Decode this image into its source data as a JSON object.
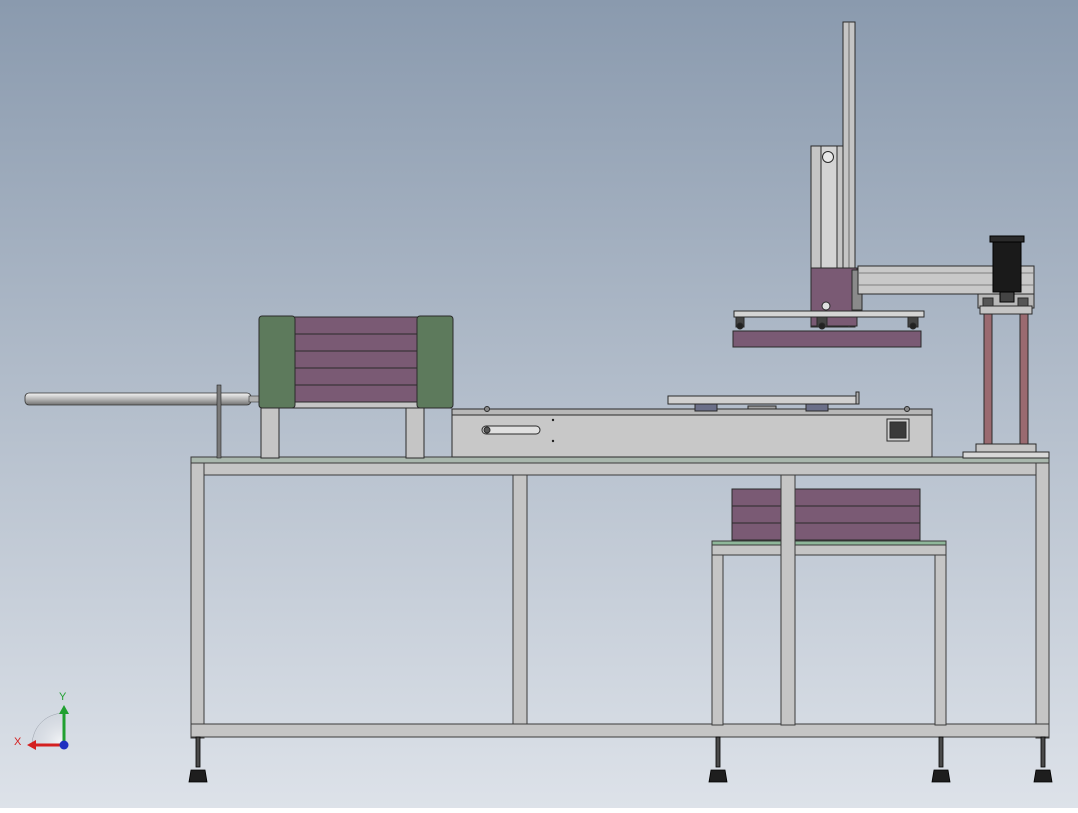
{
  "viewport": {
    "background_top": "#8a9aae",
    "background_bottom": "#dde2e9"
  },
  "colors": {
    "frame": "#c5c5c5",
    "frame_edge": "#3a3a3a",
    "purple_layer": "#7a5a74",
    "green_guard": "#5d7a5c",
    "dark_motor": "#1a1a1a",
    "rod_silver": "#d8d8d8",
    "x_axis": "#d42020",
    "y_axis": "#20a030",
    "z_axis": "#2030c0"
  },
  "triad": {
    "x_label": "X",
    "y_label": "Y"
  }
}
